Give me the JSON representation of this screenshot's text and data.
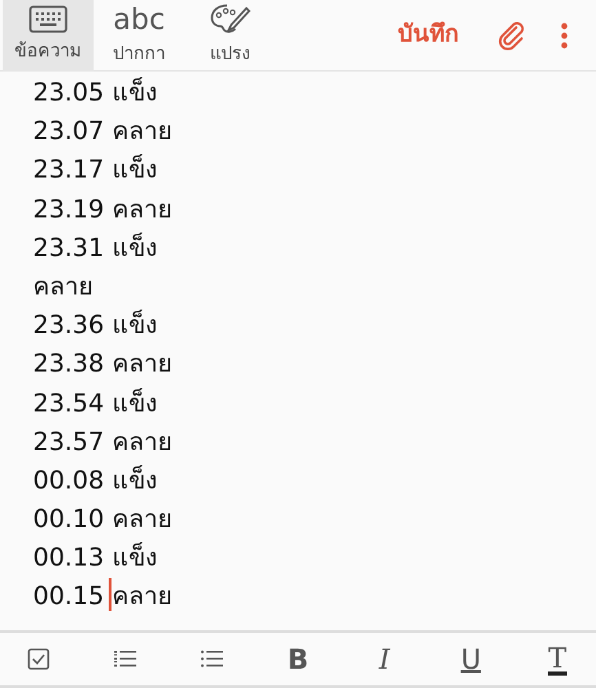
{
  "modes": [
    {
      "kind": "keyboard",
      "label": "ข้อความ",
      "selected": true
    },
    {
      "kind": "text",
      "glyph": "abc",
      "label": "ปากกา",
      "selected": false
    },
    {
      "kind": "palette",
      "label": "แปรง",
      "selected": false
    }
  ],
  "save_button": "บันทึก",
  "lines": [
    {
      "text": "23.05 แข็ง"
    },
    {
      "text": "23.07 คลาย"
    },
    {
      "text": "23.17 แข็ง"
    },
    {
      "text": "23.19 คลาย"
    },
    {
      "text": "23.31 แข็ง"
    },
    {
      "text": "คลาย"
    },
    {
      "text": "23.36 แข็ง"
    },
    {
      "text": "23.38 คลาย"
    },
    {
      "text": "23.54 แข็ง"
    },
    {
      "text": "23.57 คลาย"
    },
    {
      "text": "00.08 แข็ง"
    },
    {
      "text": "00.10 คลาย"
    },
    {
      "text": "00.13 แข็ง"
    },
    {
      "text": "00.15",
      "cursor": true,
      "text_after": "คลาย"
    }
  ],
  "format_tools": [
    {
      "kind": "checkbox"
    },
    {
      "kind": "numbered"
    },
    {
      "kind": "bullets"
    },
    {
      "kind": "bold",
      "glyph": "B"
    },
    {
      "kind": "italic",
      "glyph": "I"
    },
    {
      "kind": "underline",
      "glyph": "U"
    },
    {
      "kind": "textcolor",
      "glyph": "T"
    }
  ]
}
